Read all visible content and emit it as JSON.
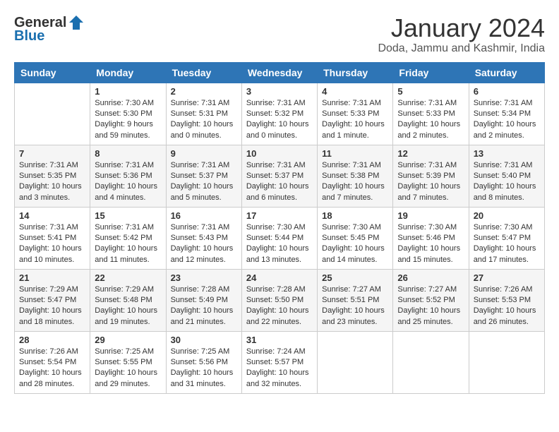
{
  "header": {
    "logo_general": "General",
    "logo_blue": "Blue",
    "month_title": "January 2024",
    "location": "Doda, Jammu and Kashmir, India"
  },
  "weekdays": [
    "Sunday",
    "Monday",
    "Tuesday",
    "Wednesday",
    "Thursday",
    "Friday",
    "Saturday"
  ],
  "weeks": [
    [
      {
        "day": "",
        "info": ""
      },
      {
        "day": "1",
        "info": "Sunrise: 7:30 AM\nSunset: 5:30 PM\nDaylight: 9 hours\nand 59 minutes."
      },
      {
        "day": "2",
        "info": "Sunrise: 7:31 AM\nSunset: 5:31 PM\nDaylight: 10 hours\nand 0 minutes."
      },
      {
        "day": "3",
        "info": "Sunrise: 7:31 AM\nSunset: 5:32 PM\nDaylight: 10 hours\nand 0 minutes."
      },
      {
        "day": "4",
        "info": "Sunrise: 7:31 AM\nSunset: 5:33 PM\nDaylight: 10 hours\nand 1 minute."
      },
      {
        "day": "5",
        "info": "Sunrise: 7:31 AM\nSunset: 5:33 PM\nDaylight: 10 hours\nand 2 minutes."
      },
      {
        "day": "6",
        "info": "Sunrise: 7:31 AM\nSunset: 5:34 PM\nDaylight: 10 hours\nand 2 minutes."
      }
    ],
    [
      {
        "day": "7",
        "info": "Sunrise: 7:31 AM\nSunset: 5:35 PM\nDaylight: 10 hours\nand 3 minutes."
      },
      {
        "day": "8",
        "info": "Sunrise: 7:31 AM\nSunset: 5:36 PM\nDaylight: 10 hours\nand 4 minutes."
      },
      {
        "day": "9",
        "info": "Sunrise: 7:31 AM\nSunset: 5:37 PM\nDaylight: 10 hours\nand 5 minutes."
      },
      {
        "day": "10",
        "info": "Sunrise: 7:31 AM\nSunset: 5:37 PM\nDaylight: 10 hours\nand 6 minutes."
      },
      {
        "day": "11",
        "info": "Sunrise: 7:31 AM\nSunset: 5:38 PM\nDaylight: 10 hours\nand 7 minutes."
      },
      {
        "day": "12",
        "info": "Sunrise: 7:31 AM\nSunset: 5:39 PM\nDaylight: 10 hours\nand 7 minutes."
      },
      {
        "day": "13",
        "info": "Sunrise: 7:31 AM\nSunset: 5:40 PM\nDaylight: 10 hours\nand 8 minutes."
      }
    ],
    [
      {
        "day": "14",
        "info": "Sunrise: 7:31 AM\nSunset: 5:41 PM\nDaylight: 10 hours\nand 10 minutes."
      },
      {
        "day": "15",
        "info": "Sunrise: 7:31 AM\nSunset: 5:42 PM\nDaylight: 10 hours\nand 11 minutes."
      },
      {
        "day": "16",
        "info": "Sunrise: 7:31 AM\nSunset: 5:43 PM\nDaylight: 10 hours\nand 12 minutes."
      },
      {
        "day": "17",
        "info": "Sunrise: 7:30 AM\nSunset: 5:44 PM\nDaylight: 10 hours\nand 13 minutes."
      },
      {
        "day": "18",
        "info": "Sunrise: 7:30 AM\nSunset: 5:45 PM\nDaylight: 10 hours\nand 14 minutes."
      },
      {
        "day": "19",
        "info": "Sunrise: 7:30 AM\nSunset: 5:46 PM\nDaylight: 10 hours\nand 15 minutes."
      },
      {
        "day": "20",
        "info": "Sunrise: 7:30 AM\nSunset: 5:47 PM\nDaylight: 10 hours\nand 17 minutes."
      }
    ],
    [
      {
        "day": "21",
        "info": "Sunrise: 7:29 AM\nSunset: 5:47 PM\nDaylight: 10 hours\nand 18 minutes."
      },
      {
        "day": "22",
        "info": "Sunrise: 7:29 AM\nSunset: 5:48 PM\nDaylight: 10 hours\nand 19 minutes."
      },
      {
        "day": "23",
        "info": "Sunrise: 7:28 AM\nSunset: 5:49 PM\nDaylight: 10 hours\nand 21 minutes."
      },
      {
        "day": "24",
        "info": "Sunrise: 7:28 AM\nSunset: 5:50 PM\nDaylight: 10 hours\nand 22 minutes."
      },
      {
        "day": "25",
        "info": "Sunrise: 7:27 AM\nSunset: 5:51 PM\nDaylight: 10 hours\nand 23 minutes."
      },
      {
        "day": "26",
        "info": "Sunrise: 7:27 AM\nSunset: 5:52 PM\nDaylight: 10 hours\nand 25 minutes."
      },
      {
        "day": "27",
        "info": "Sunrise: 7:26 AM\nSunset: 5:53 PM\nDaylight: 10 hours\nand 26 minutes."
      }
    ],
    [
      {
        "day": "28",
        "info": "Sunrise: 7:26 AM\nSunset: 5:54 PM\nDaylight: 10 hours\nand 28 minutes."
      },
      {
        "day": "29",
        "info": "Sunrise: 7:25 AM\nSunset: 5:55 PM\nDaylight: 10 hours\nand 29 minutes."
      },
      {
        "day": "30",
        "info": "Sunrise: 7:25 AM\nSunset: 5:56 PM\nDaylight: 10 hours\nand 31 minutes."
      },
      {
        "day": "31",
        "info": "Sunrise: 7:24 AM\nSunset: 5:57 PM\nDaylight: 10 hours\nand 32 minutes."
      },
      {
        "day": "",
        "info": ""
      },
      {
        "day": "",
        "info": ""
      },
      {
        "day": "",
        "info": ""
      }
    ]
  ]
}
